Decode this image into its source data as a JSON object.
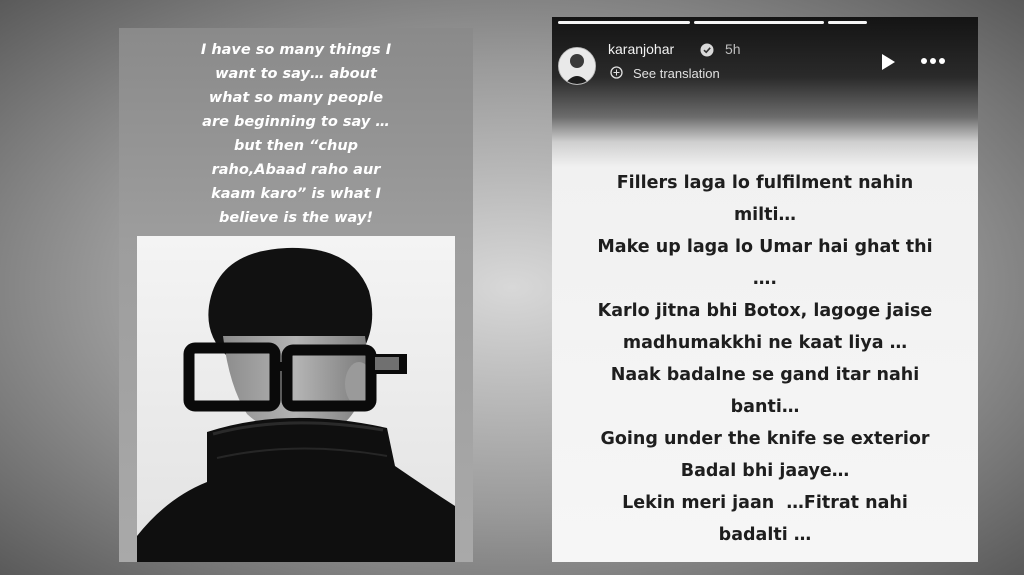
{
  "left_story": {
    "caption": "I have so many things I\nwant to say… about\nwhat so many people\nare beginning to say …\nbut then “chup\nraho,Abaad raho aur\nkaam karo” is what I\nbelieve is the way!",
    "image_icon": "portrait-photo"
  },
  "right_story": {
    "header": {
      "username": "karanjohar",
      "time": "5h",
      "see_translation": "See translation",
      "icons": [
        "avatar",
        "verified-badge-icon",
        "translate-icon",
        "play-icon",
        "more-icon"
      ]
    },
    "lines": [
      "Fillers laga lo fulfilment nahin",
      "milti…",
      "Make up laga lo Umar hai ghat thi",
      "….",
      "Karlo jitna bhi Botox, lagoge jaise",
      "madhumakkhi ne kaat liya …",
      "Naak badalne se gand itar nahi",
      "banti…",
      "Going under the knife se exterior",
      "Badal bhi jaaye…",
      "Lekin meri jaan  …Fitrat nahi",
      "badalti …"
    ]
  }
}
